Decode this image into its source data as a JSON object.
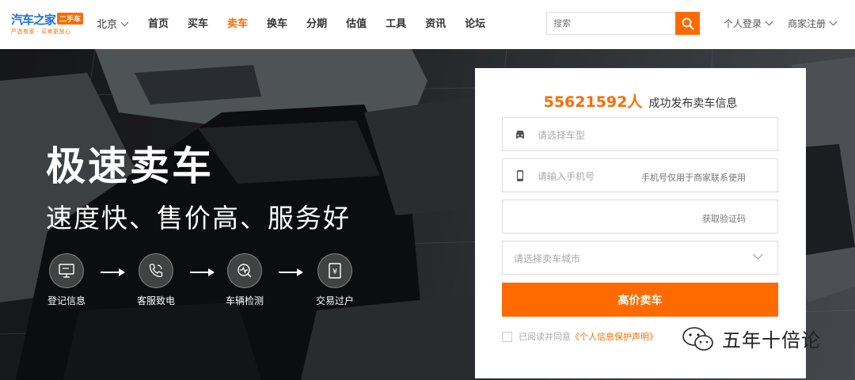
{
  "header": {
    "logo_main": "汽车之家",
    "logo_badge": "二手车",
    "logo_sub": "严选有家 · 买卖更放心",
    "city": "北京",
    "nav": [
      "首页",
      "买车",
      "卖车",
      "换车",
      "分期",
      "估值",
      "工具",
      "资讯",
      "论坛"
    ],
    "active_nav": "卖车",
    "search_placeholder": "搜索",
    "login": "个人登录",
    "register": "商家注册"
  },
  "hero": {
    "title": "极速卖车",
    "subtitle": "速度快、售价高、服务好",
    "steps": [
      {
        "label": "登记信息",
        "icon": "monitor-icon"
      },
      {
        "label": "客服致电",
        "icon": "phone-icon"
      },
      {
        "label": "车辆检测",
        "icon": "inspection-icon"
      },
      {
        "label": "交易过户",
        "icon": "yen-document-icon"
      }
    ]
  },
  "form": {
    "count": "55621592人",
    "count_suffix": "成功发布卖车信息",
    "model_placeholder": "请选择车型",
    "phone_placeholder": "请输入手机号",
    "phone_note": "手机号仅用于商家联系使用",
    "code_button": "获取验证码",
    "city_placeholder": "请选择卖车城市",
    "submit": "高价卖车",
    "agree_text": "已阅读并同意",
    "agree_link": "《个人信息保护声明》"
  },
  "watermark": "五年十倍论",
  "colors": {
    "accent": "#ff6a00",
    "brand_blue": "#1d6fd8"
  }
}
